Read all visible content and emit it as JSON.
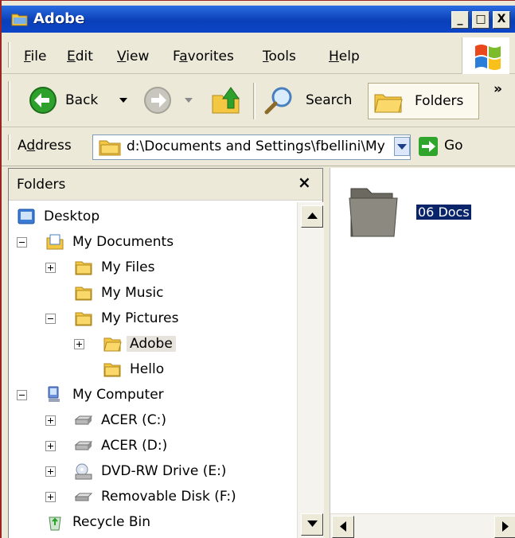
{
  "window": {
    "title": "Adobe",
    "buttons": [
      "_",
      "□",
      "X"
    ]
  },
  "menu": {
    "items": [
      {
        "u": "F",
        "rest": "ile"
      },
      {
        "u": "E",
        "rest": "dit"
      },
      {
        "u": "V",
        "rest": "iew"
      },
      {
        "pre": "F",
        "u": "a",
        "rest": "vorites"
      },
      {
        "u": "T",
        "rest": "ools"
      },
      {
        "u": "H",
        "rest": "elp"
      }
    ]
  },
  "toolbar": {
    "back_label": "Back",
    "search_label": "Search",
    "folders_label": "Folders",
    "more_label": "»"
  },
  "address": {
    "label_pre": "A",
    "label_u": "d",
    "label_rest": "dress",
    "value": "d:\\Documents and Settings\\fbellini\\My",
    "go_label": "Go"
  },
  "folders_pane": {
    "title": "Folders",
    "close": "×",
    "tree": [
      {
        "label": "Desktop",
        "icon": "desktop-icon"
      },
      {
        "label": "My Documents",
        "icon": "my-documents-icon"
      },
      {
        "label": "My Files",
        "icon": "folder-icon"
      },
      {
        "label": "My Music",
        "icon": "folder-icon"
      },
      {
        "label": "My Pictures",
        "icon": "folder-icon"
      },
      {
        "label": "Adobe",
        "icon": "folder-open-icon"
      },
      {
        "label": "Hello",
        "icon": "folder-icon"
      },
      {
        "label": "My Computer",
        "icon": "computer-icon"
      },
      {
        "label": "ACER (C:)",
        "icon": "drive-icon"
      },
      {
        "label": "ACER (D:)",
        "icon": "drive-icon"
      },
      {
        "label": "DVD-RW Drive (E:)",
        "icon": "dvd-drive-icon"
      },
      {
        "label": "Removable Disk (F:)",
        "icon": "removable-disk-icon"
      },
      {
        "label": "Recycle Bin",
        "icon": "recycle-bin-icon"
      }
    ]
  },
  "content": {
    "items": [
      {
        "label": "06 Docs",
        "icon": "folder-icon",
        "selected": true
      }
    ]
  }
}
